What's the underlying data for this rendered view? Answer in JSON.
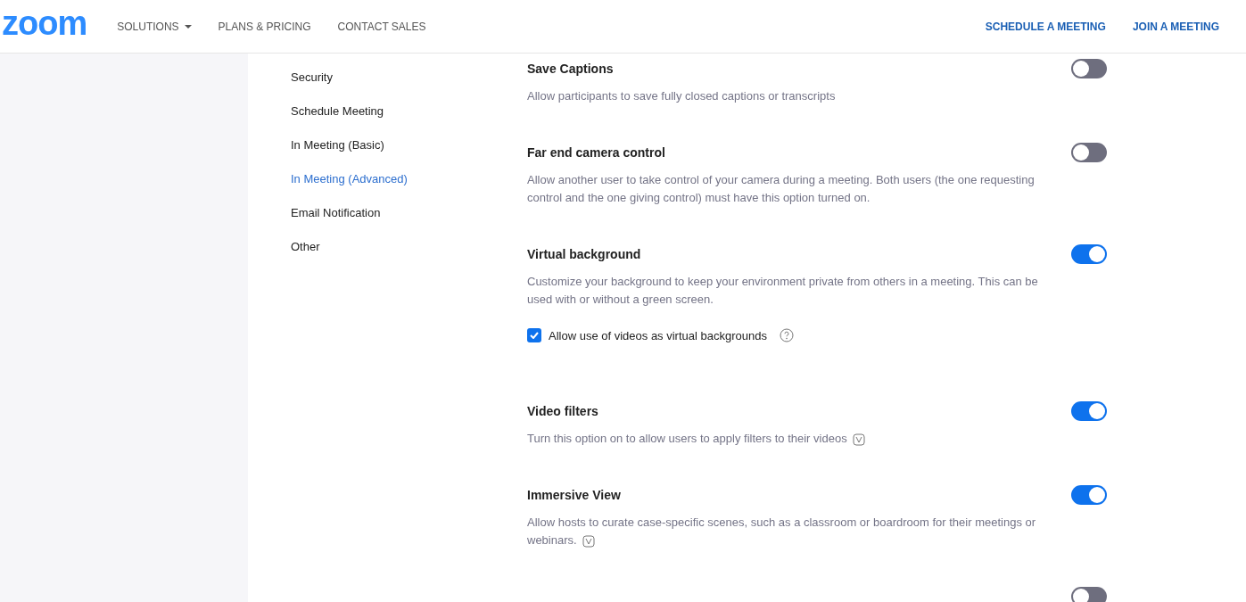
{
  "header": {
    "logo": "zoom",
    "nav": [
      {
        "label": "SOLUTIONS",
        "dropdown": true
      },
      {
        "label": "PLANS & PRICING",
        "dropdown": false
      },
      {
        "label": "CONTACT SALES",
        "dropdown": false
      }
    ],
    "actions": [
      "SCHEDULE A MEETING",
      "JOIN A MEETING"
    ]
  },
  "sidebar": {
    "items": [
      {
        "label": "Security",
        "selected": false
      },
      {
        "label": "Schedule Meeting",
        "selected": false
      },
      {
        "label": "In Meeting (Basic)",
        "selected": false
      },
      {
        "label": "In Meeting (Advanced)",
        "selected": true
      },
      {
        "label": "Email Notification",
        "selected": false
      },
      {
        "label": "Other",
        "selected": false
      }
    ]
  },
  "settings": [
    {
      "title": "Save Captions",
      "description": "Allow participants to save fully closed captions or transcripts",
      "on": false
    },
    {
      "title": "Far end camera control",
      "description": "Allow another user to take control of your camera during a meeting. Both users (the one requesting control and the one giving control) must have this option turned on.",
      "on": false
    },
    {
      "title": "Virtual background",
      "description": "Customize your background to keep your environment private from others in a meeting. This can be used with or without a green screen.",
      "on": true,
      "options": [
        {
          "label": "Allow use of videos as virtual backgrounds",
          "checked": true,
          "help": true
        }
      ]
    },
    {
      "title": "Video filters",
      "description": "Turn this option on to allow users to apply filters to their videos",
      "on": true,
      "version_badge": true
    },
    {
      "title": "Immersive View",
      "description": "Allow hosts to curate case-specific scenes, such as a classroom or boardroom for their meetings or webinars.",
      "on": true,
      "version_badge": true
    },
    {
      "on": false
    }
  ]
}
